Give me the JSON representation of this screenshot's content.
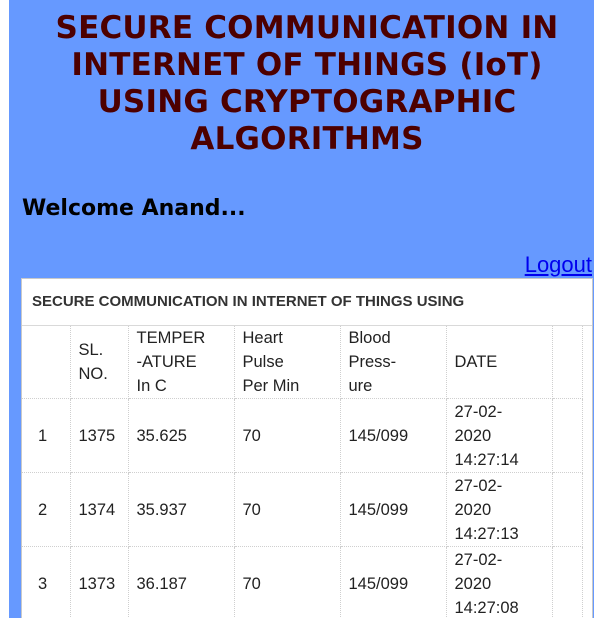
{
  "header": {
    "title_lines": [
      "SECURE COMMUNICATION IN",
      "INTERNET OF THINGS (IoT)",
      "USING CRYPTOGRAPHIC",
      "ALGORITHMS"
    ],
    "welcome_text": "Welcome Anand...",
    "logout_label": "Logout"
  },
  "table": {
    "caption": "SECURE COMMUNICATION IN INTERNET OF THINGS USING",
    "columns": [
      "",
      "SL.\nNO.",
      "TEMPER\n-ATURE\nIn C",
      "Heart\nPulse\nPer Min",
      "Blood\nPress-\nure",
      "DATE",
      ""
    ],
    "rows": [
      {
        "idx": "1",
        "sl_no": "1375",
        "temperature": "35.625",
        "heart_pulse": "70",
        "blood_pressure": "145/099",
        "date": "27-02-\n2020\n14:27:14"
      },
      {
        "idx": "2",
        "sl_no": "1374",
        "temperature": "35.937",
        "heart_pulse": "70",
        "blood_pressure": "145/099",
        "date": "27-02-\n2020\n14:27:13"
      },
      {
        "idx": "3",
        "sl_no": "1373",
        "temperature": "36.187",
        "heart_pulse": "70",
        "blood_pressure": "145/099",
        "date": "27-02-\n2020\n14:27:08"
      }
    ]
  },
  "colors": {
    "page_background": "#6699ff",
    "title_color": "#4d0000",
    "link_color": "#0000ee"
  }
}
